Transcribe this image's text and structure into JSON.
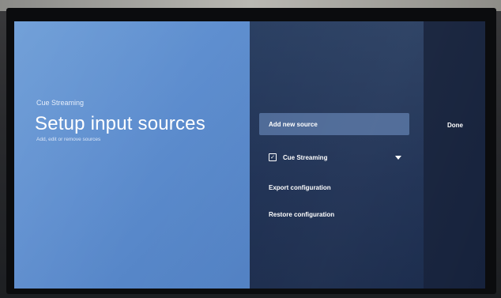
{
  "app": {
    "breadcrumb": "Cue Streaming",
    "title": "Setup input sources",
    "description": "Add, edit or remove sources"
  },
  "menu": {
    "items": [
      {
        "label": "Add new source",
        "selected": true
      },
      {
        "label": "Cue Streaming",
        "checked": true,
        "expandable": true
      },
      {
        "label": "Export configuration"
      },
      {
        "label": "Restore configuration"
      }
    ]
  },
  "actions": {
    "done_label": "Done"
  },
  "colors": {
    "left_pane": "#5e8ecf",
    "right_pane": "#1f3154",
    "selected_item": "#4e6a97"
  },
  "icons": {
    "checkbox": "checkbox-checked-icon",
    "dropdown": "caret-down-icon"
  }
}
